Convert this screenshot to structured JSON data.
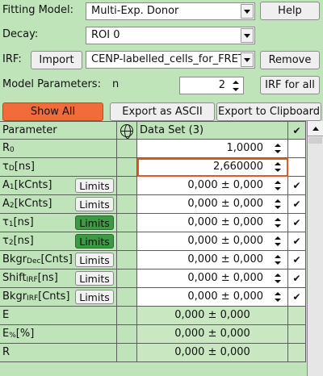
{
  "model": {
    "label": "Fitting Model:",
    "value": "Multi-Exp. Donor",
    "help": "Help"
  },
  "decay": {
    "label": "Decay:",
    "value": "ROI 0"
  },
  "irf": {
    "label": "IRF:",
    "import": "Import",
    "value": "CENP-labelled_cells_for_FRET_",
    "remove": "Remove"
  },
  "params": {
    "label": "Model Parameters:",
    "n_label": "n",
    "n_value": "2",
    "irf_all": "IRF for all"
  },
  "toolbar": {
    "show_all": "Show All",
    "export_ascii": "Export as ASCII",
    "export_clip": "Export to Clipboard"
  },
  "table": {
    "header_param": "Parameter",
    "header_set": "Data Set (3)",
    "header_check": "✔",
    "limits_label": "Limits",
    "rows": [
      {
        "name": "R",
        "sub": "0",
        "unit": "",
        "value": "1,0000",
        "limits": false,
        "spin": true,
        "check": ""
      },
      {
        "name": "τ",
        "sub": "D",
        "unit": "[ns]",
        "value": "2,660000",
        "limits": false,
        "spin": true,
        "check": ""
      },
      {
        "name": "A",
        "sub": "1",
        "unit": "[kCnts]",
        "value": "0,000 ± 0,000",
        "limits": true,
        "spin": true,
        "check": "✔"
      },
      {
        "name": "A",
        "sub": "2",
        "unit": "[kCnts]",
        "value": "0,000 ± 0,000",
        "limits": true,
        "spin": true,
        "check": "✔"
      },
      {
        "name": "τ",
        "sub": "1",
        "unit": "[ns]",
        "value": "0,000 ± 0,000",
        "limits": true,
        "spin": true,
        "check": "✔"
      },
      {
        "name": "τ",
        "sub": "2",
        "unit": "[ns]",
        "value": "0,000 ± 0,000",
        "limits": true,
        "spin": true,
        "check": "✔"
      },
      {
        "name": "Bkgr",
        "sub": "Dec",
        "unit": "[Cnts]",
        "value": "0,000 ± 0,000",
        "limits": true,
        "spin": true,
        "check": "✔"
      },
      {
        "name": "Shift",
        "sub": "IRF",
        "unit": "[ns]",
        "value": "0,000 ± 0,000",
        "limits": true,
        "spin": true,
        "check": "✔"
      },
      {
        "name": "Bkgr",
        "sub": "IRF",
        "unit": "[Cnts]",
        "value": "0,000 ± 0,000",
        "limits": true,
        "spin": true,
        "check": "✔"
      },
      {
        "name": "E",
        "sub": "",
        "unit": "",
        "value": "0,000 ± 0,000",
        "limits": false,
        "spin": false,
        "check": ""
      },
      {
        "name": "E",
        "sub": "%",
        "unit": "[%]",
        "value": "0,000 ± 0,000",
        "limits": false,
        "spin": false,
        "check": ""
      },
      {
        "name": "R",
        "sub": "",
        "unit": "",
        "value": "0,000 ± 0,000",
        "limits": false,
        "spin": false,
        "check": ""
      }
    ]
  },
  "colors": {
    "background": "#bfe4b9",
    "accent_orange": "#f26b3a",
    "limits_active": "#3c9a45"
  },
  "icons": {
    "globe": "globe-icon",
    "dropdown": "chevron-down-icon"
  }
}
